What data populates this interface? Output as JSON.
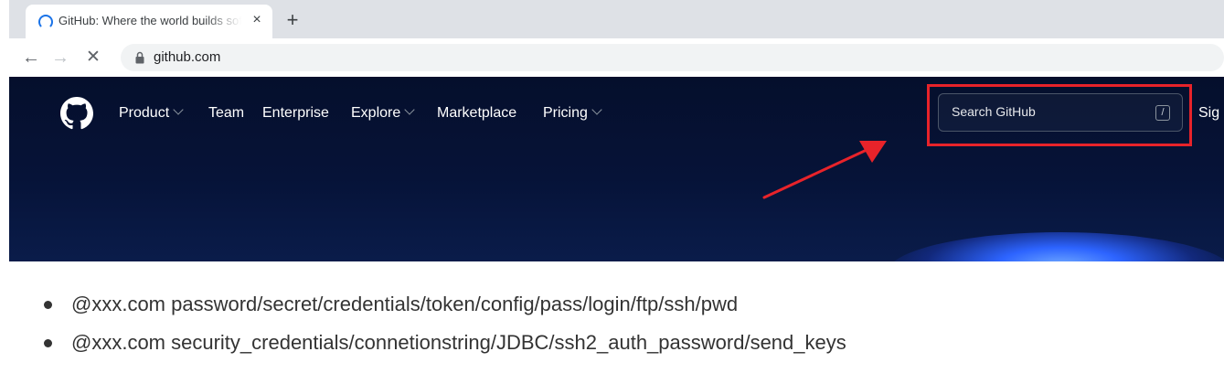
{
  "browser": {
    "tab_title": "GitHub: Where the world builds software",
    "tab_close": "×",
    "new_tab": "+",
    "url": "github.com",
    "back": "←",
    "forward": "→",
    "stop": "✕"
  },
  "github": {
    "nav": [
      {
        "label": "Product",
        "dropdown": true
      },
      {
        "label": "Team",
        "dropdown": false
      },
      {
        "label": "Enterprise",
        "dropdown": false
      },
      {
        "label": "Explore",
        "dropdown": true
      },
      {
        "label": "Marketplace",
        "dropdown": false
      },
      {
        "label": "Pricing",
        "dropdown": true
      }
    ],
    "search_placeholder": "Search GitHub",
    "search_shortcut": "/",
    "sign_in_visible": "Sig"
  },
  "annotation": {
    "highlight_color": "#e8232a"
  },
  "bullets": [
    "@xxx.com password/secret/credentials/token/config/pass/login/ftp/ssh/pwd",
    "@xxx.com security_credentials/connetionstring/JDBC/ssh2_auth_password/send_keys"
  ]
}
